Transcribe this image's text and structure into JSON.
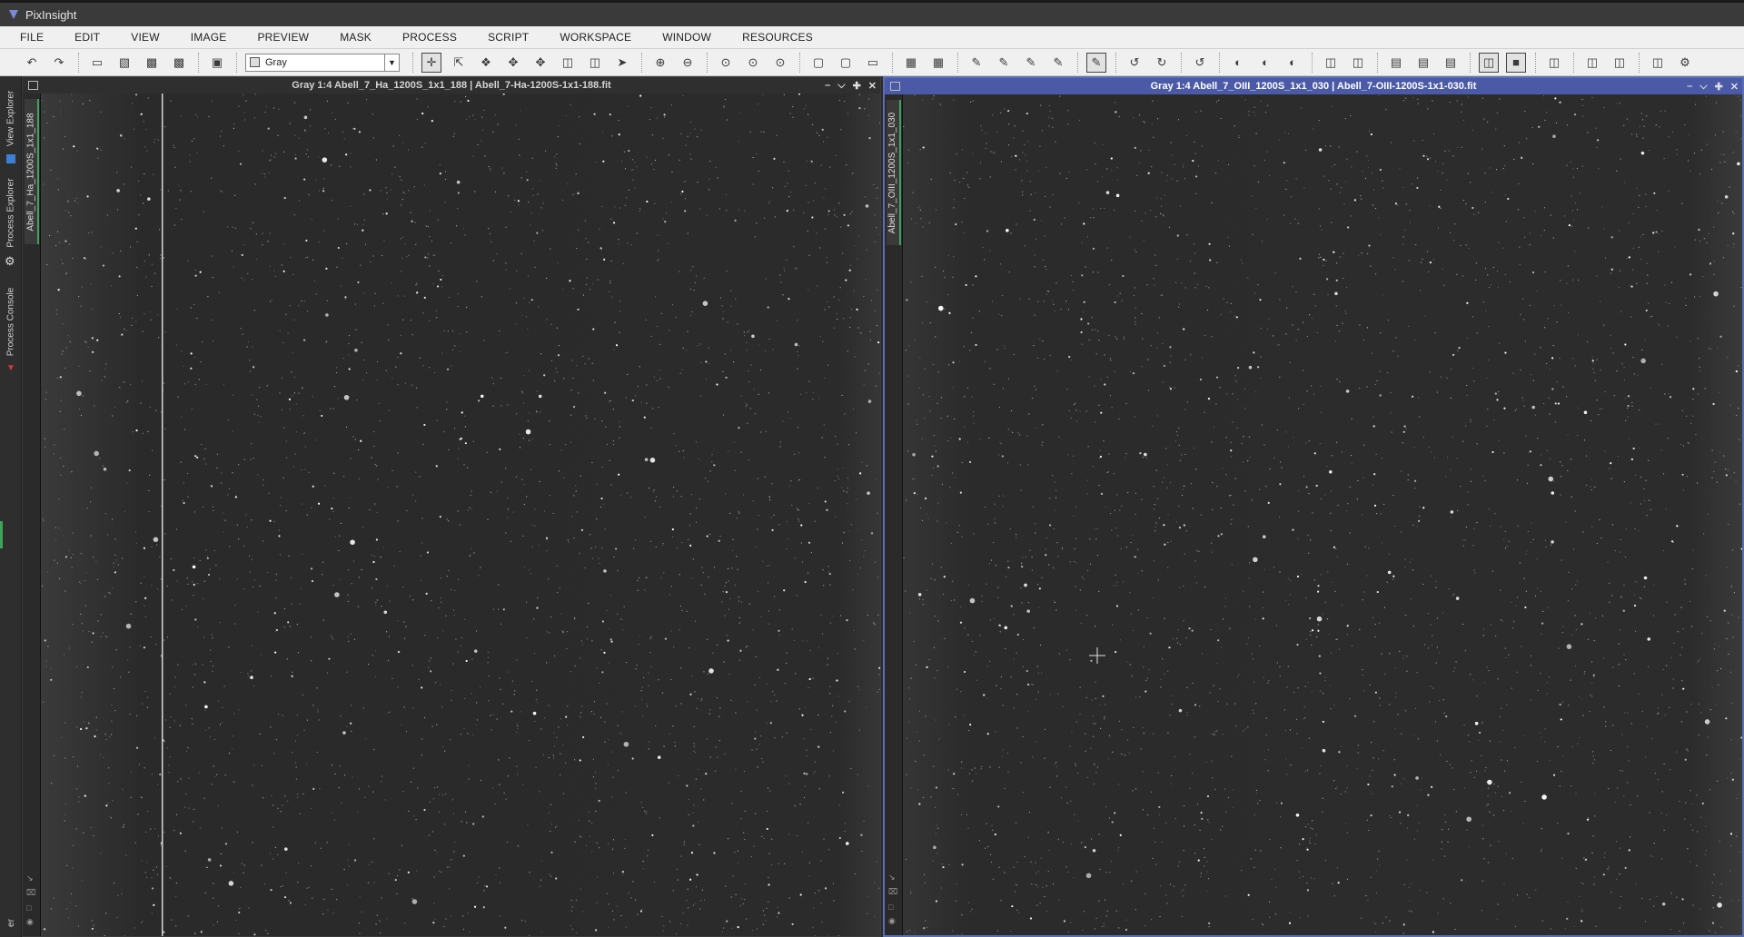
{
  "app": {
    "title": "PixInsight"
  },
  "menu": [
    "FILE",
    "EDIT",
    "VIEW",
    "IMAGE",
    "PREVIEW",
    "MASK",
    "PROCESS",
    "SCRIPT",
    "WORKSPACE",
    "WINDOW",
    "RESOURCES"
  ],
  "toolbar": {
    "channel_combo": "Gray"
  },
  "left_dock": {
    "tabs": [
      "View Explorer",
      "Process Explorer",
      "Process Console"
    ],
    "bottom_text": "er"
  },
  "windows": [
    {
      "title": "Gray 1:4 Abell_7_Ha_1200S_1x1_188 | Abell_7-Ha-1200S-1x1-188.fit",
      "tab_label": "Abell_7_Ha_1200S_1x1_188",
      "active": false
    },
    {
      "title": "Gray 1:4 Abell_7_OIII_1200S_1x1_030 | Abell_7-OIII-1200S-1x1-030.fit",
      "tab_label": "Abell_7_OIII_1200S_1x1_030",
      "active": true
    }
  ],
  "colors": {
    "active_title": "#4b5aa6",
    "tab_accent": "#3fa35a",
    "sky": "#2a2a2a"
  }
}
